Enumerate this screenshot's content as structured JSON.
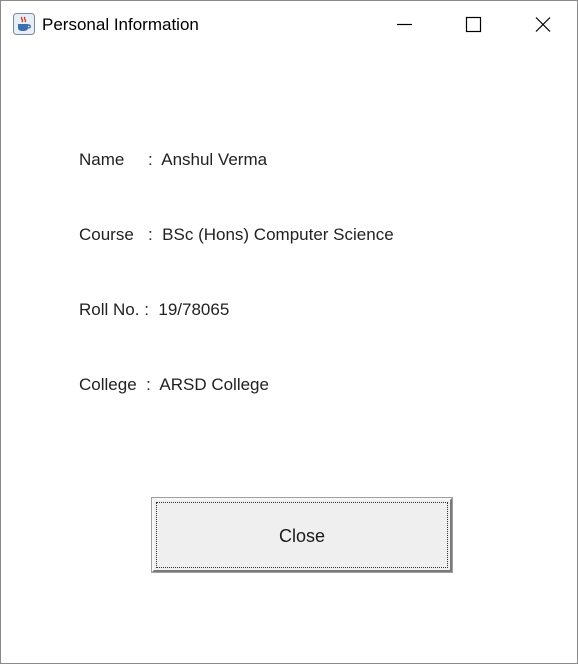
{
  "window": {
    "title": "Personal Information",
    "icon": "java-coffee-icon"
  },
  "titlebar_buttons": {
    "minimize": "minimize-icon",
    "maximize": "maximize-icon",
    "close": "close-icon"
  },
  "fields": {
    "name": {
      "label": "Name",
      "separator": ":",
      "value": "Anshul Verma"
    },
    "course": {
      "label": "Course",
      "separator": ":",
      "value": "BSc (Hons) Computer Science"
    },
    "roll": {
      "label": "Roll No.",
      "separator": ":",
      "value": "19/78065"
    },
    "college": {
      "label": "College",
      "separator": ":",
      "value": "ARSD College"
    }
  },
  "actions": {
    "close_label": "Close"
  },
  "colors": {
    "window_bg": "#ffffff",
    "button_bg": "#efefef",
    "text": "#222222"
  }
}
